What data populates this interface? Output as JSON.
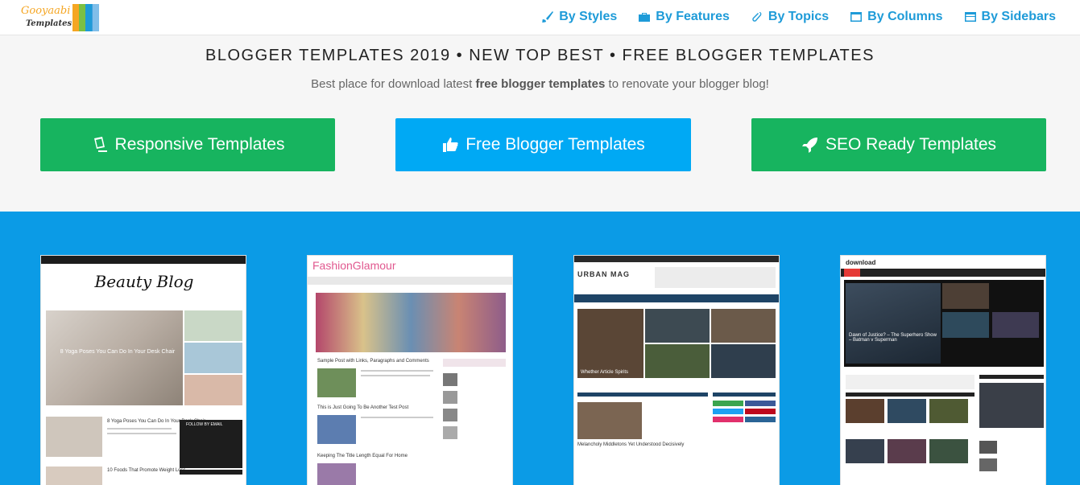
{
  "logo": {
    "name": "Gooyaabi",
    "sub": "Templates"
  },
  "nav": [
    {
      "label": "By Styles",
      "icon": "brush-icon"
    },
    {
      "label": "By Features",
      "icon": "briefcase-icon"
    },
    {
      "label": "By Topics",
      "icon": "paperclip-icon"
    },
    {
      "label": "By Columns",
      "icon": "columns-icon"
    },
    {
      "label": "By Sidebars",
      "icon": "sidebar-icon"
    }
  ],
  "hero": {
    "title": "BLOGGER TEMPLATES 2019 • NEW TOP BEST • FREE BLOGGER TEMPLATES",
    "sub_pre": "Best place for download latest ",
    "sub_bold": "free blogger templates",
    "sub_post": " to renovate your blogger blog!"
  },
  "cta": [
    {
      "label": "Responsive Templates",
      "icon": "responsive-icon",
      "color": "#17b45f"
    },
    {
      "label": "Free Blogger Templates",
      "icon": "thumbs-up-icon",
      "color": "#00a9f4"
    },
    {
      "label": "SEO Ready Templates",
      "icon": "rocket-icon",
      "color": "#17b45f"
    }
  ],
  "colors": {
    "accent": "#1e9bd8",
    "showcase_bg": "#0b9be6",
    "green": "#17b45f"
  },
  "thumbs": [
    {
      "title": "Beauty Blog",
      "featured": "8 Yoga Poses You Can Do In Your Desk Chair",
      "post1": "8 Yoga Poses You Can Do In Your Desk Chair",
      "post2": "10 Foods That Promote Weight Loss",
      "widget": "FOLLOW BY EMAIL"
    },
    {
      "title": "FashionGlamour",
      "post1": "Sample Post with Links, Paragraphs and Comments",
      "post2": "This is Just Going To Be Another Test Post",
      "post3": "Keeping The Title Length Equal For Home"
    },
    {
      "title": "URBAN MAG",
      "post1": "Whether Article Spirits",
      "post2": "Melancholy Middletons Yet Understood Decisively"
    },
    {
      "title": "download",
      "featured": "Dawn of Justice? – The Superhero Show – Batman v Superman"
    }
  ]
}
